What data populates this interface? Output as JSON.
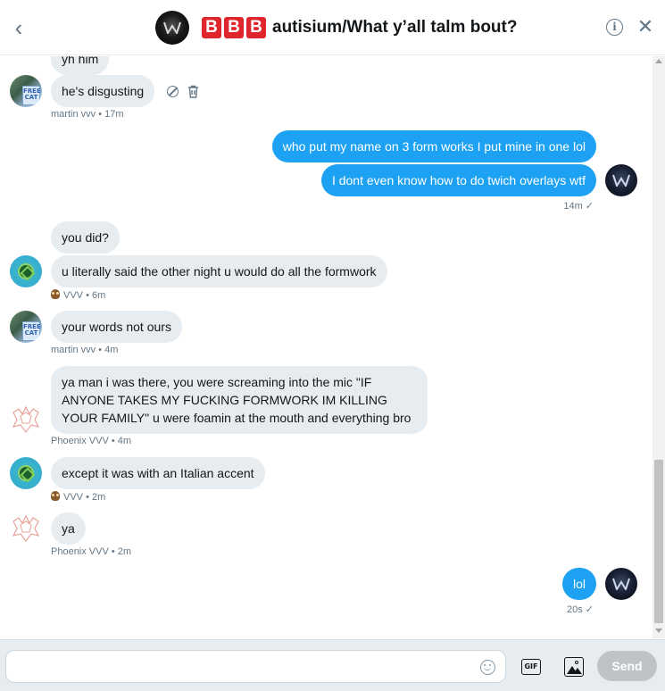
{
  "header": {
    "back_label": "‹",
    "badges": [
      "B",
      "B",
      "B"
    ],
    "title": "autisium/What y’all talm bout?",
    "info_label": "i",
    "close_label": "✕"
  },
  "messages": [
    {
      "author": "martin vvv",
      "side": "in",
      "text": "yh him"
    },
    {
      "author": "martin vvv",
      "side": "in",
      "text": "he's disgusting"
    },
    {
      "meta": "martin vvv • 17m"
    },
    {
      "author": "self",
      "side": "out",
      "text": "who put my name on 3 form works I put mine in one lol"
    },
    {
      "author": "self",
      "side": "out",
      "text": "I dont even know how to do twich overlays wtf"
    },
    {
      "meta": "14m ✓"
    },
    {
      "author": "VVV",
      "side": "in",
      "text": "you did?"
    },
    {
      "author": "VVV",
      "side": "in",
      "text": "u literally said the other night u would do all the formwork"
    },
    {
      "meta": "VVV • 6m"
    },
    {
      "author": "martin vvv",
      "side": "in",
      "text": "your words not ours"
    },
    {
      "meta": "martin vvv • 4m"
    },
    {
      "author": "Phoenix VVV",
      "side": "in",
      "text": "ya man i was there, you were screaming into the mic \"IF ANYONE TAKES MY FUCKING FORMWORK IM KILLING YOUR FAMILY\" u were foamin at the mouth and everything bro"
    },
    {
      "meta": "Phoenix VVV • 4m"
    },
    {
      "author": "VVV",
      "side": "in",
      "text": "except it was with an Italian accent"
    },
    {
      "meta": "VVV • 2m"
    },
    {
      "author": "Phoenix VVV",
      "side": "in",
      "text": "ya"
    },
    {
      "meta": "Phoenix VVV • 2m"
    },
    {
      "author": "self",
      "side": "out",
      "text": "lol"
    },
    {
      "meta": "20s ✓"
    }
  ],
  "avatars": {
    "martin_sign": "FREE CAT"
  },
  "composer": {
    "placeholder": "",
    "value": "",
    "gif_label": "GIF",
    "send_label": "Send"
  },
  "colors": {
    "outgoing_bubble": "#1da1f2",
    "incoming_bubble": "#e6ecf0",
    "badge_red": "#e0262d",
    "send_disabled": "#bdc3c7"
  }
}
